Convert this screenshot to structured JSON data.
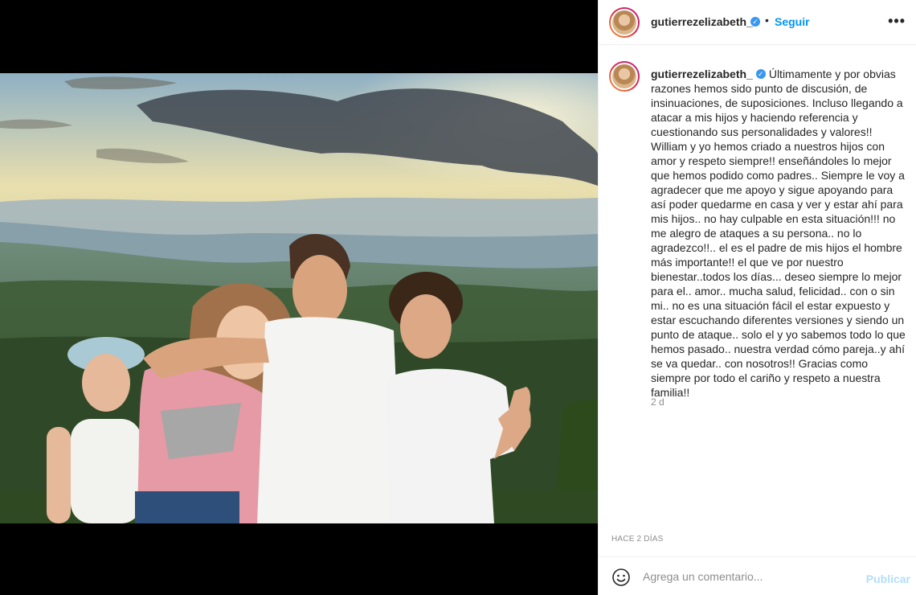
{
  "post": {
    "username": "gutierrezelizabeth_",
    "follow_label": "Seguir",
    "more_label": "•••",
    "caption_text": "Últimamente y por obvias razones hemos sido punto de discusión, de insinuaciones, de suposiciones. Incluso llegando a atacar a mis hijos y haciendo referencia y cuestionando sus personalidades y valores!! William y yo hemos criado a nuestros hijos con amor y respeto siempre!! enseñándoles lo mejor que hemos podido como padres.. Siempre le voy a agradecer que me apoyo y sigue apoyando para así poder quedarme en casa y ver y estar ahí para mis hijos.. no hay culpable en esta situación!!! no me alegro de ataques a su persona.. no lo agradezco!!.. el es el padre de mis hijos el hombre más importante!! el que ve por nuestro bienestar..todos los días... deseo siempre lo mejor para el.. amor.. mucha salud, felicidad.. con o sin mi.. no es una situación fácil el estar expuesto y estar escuchando diferentes versiones y siendo un punto de ataque.. solo el y yo sabemos todo lo que hemos pasado.. nuestra verdad cómo pareja..y ahí se va quedar.. con nosotros!! Gracias como siempre por todo el cariño y respeto a nuestra familia!!",
    "caption_age": "2 d",
    "posted_label": "HACE 2 DÍAS"
  },
  "comment": {
    "placeholder": "Agrega un comentario...",
    "publish_label": "Publicar"
  },
  "icons": {
    "verified": "verified-badge-icon",
    "emoji": "emoji-smile-icon",
    "more": "more-options-icon"
  },
  "colors": {
    "accent": "#0095f6",
    "publish_disabled": "#b2dffc",
    "verified": "#3897f0",
    "muted": "#8e8e8e"
  }
}
